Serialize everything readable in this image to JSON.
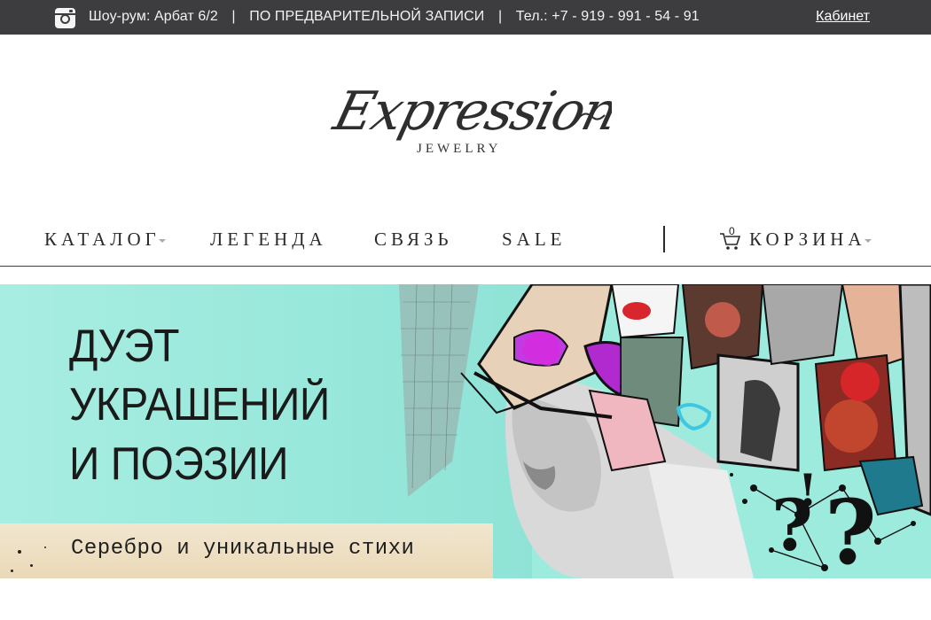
{
  "topbar": {
    "showroom": "Шоу-рум: Арбат 6/2",
    "appointment": "ПО ПРЕДВАРИТЕЛЬНОЙ ЗАПИСИ",
    "phone": "Тел.: +7 - 919 - 991 - 54 - 91",
    "separator": "|",
    "cabinet_label": "Кабинет"
  },
  "logo": {
    "wordmark": "Expression",
    "subtitle": "JEWELRY"
  },
  "nav": {
    "items": [
      {
        "label": "КАТАЛОГ"
      },
      {
        "label": "ЛЕГЕНДА"
      },
      {
        "label": "СВЯЗЬ"
      },
      {
        "label": "SALE"
      }
    ],
    "cart_label": "КОРЗИНА",
    "cart_count": "0"
  },
  "banner": {
    "headline_1": "ДУЭТ",
    "headline_2": "УКРАШЕНИЙ",
    "headline_3": "И ПОЭЗИИ",
    "tagline": "Серебро и уникальные стихи",
    "colors": {
      "background": "#9cebdd",
      "paper": "#efe2c6"
    }
  },
  "icons": {
    "social": "instagram-icon",
    "cart": "cart-icon",
    "dropdown": "chevron-down-icon"
  }
}
